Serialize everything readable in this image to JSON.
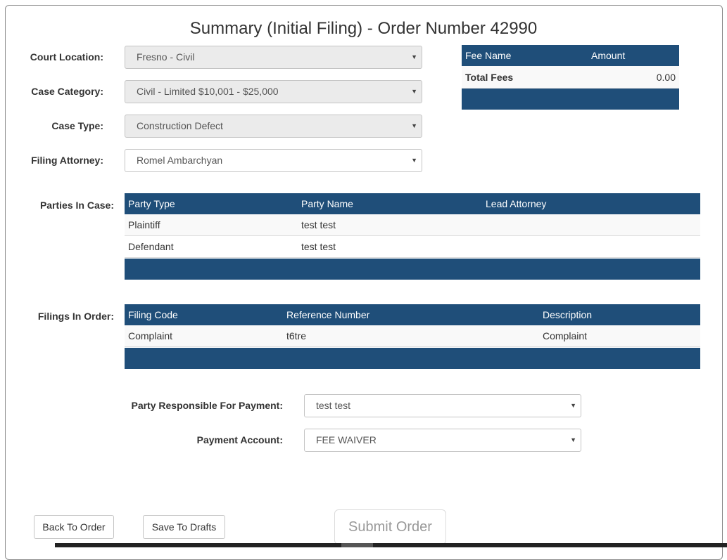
{
  "title": "Summary (Initial Filing) - Order Number 42990",
  "form": {
    "court_location": {
      "label": "Court Location:",
      "value": "Fresno - Civil"
    },
    "case_category": {
      "label": "Case Category:",
      "value": "Civil - Limited $10,001 - $25,000"
    },
    "case_type": {
      "label": "Case Type:",
      "value": "Construction Defect"
    },
    "filing_attorney": {
      "label": "Filing Attorney:",
      "value": "Romel Ambarchyan"
    }
  },
  "fees": {
    "columns": [
      "Fee Name",
      "Amount"
    ],
    "total_label": "Total Fees",
    "total_value": "0.00"
  },
  "parties": {
    "label": "Parties In Case:",
    "columns": [
      "Party Type",
      "Party Name",
      "Lead Attorney"
    ],
    "rows": [
      [
        "Plaintiff",
        "test test",
        ""
      ],
      [
        "Defendant",
        "test test",
        ""
      ]
    ]
  },
  "filings": {
    "label": "Filings In Order:",
    "columns": [
      "Filing Code",
      "Reference Number",
      "Description"
    ],
    "rows": [
      [
        "Complaint",
        "t6tre",
        "Complaint"
      ]
    ]
  },
  "payment": {
    "party_label": "Party Responsible For Payment:",
    "party_value": "test test",
    "account_label": "Payment Account:",
    "account_value": "FEE WAIVER"
  },
  "buttons": {
    "back": "Back To Order",
    "save": "Save To Drafts",
    "submit": "Submit Order"
  },
  "icons": {
    "dropdown": "▼"
  },
  "colors": {
    "table_header": "#1f4e79",
    "disabled_field": "#ebebeb"
  }
}
